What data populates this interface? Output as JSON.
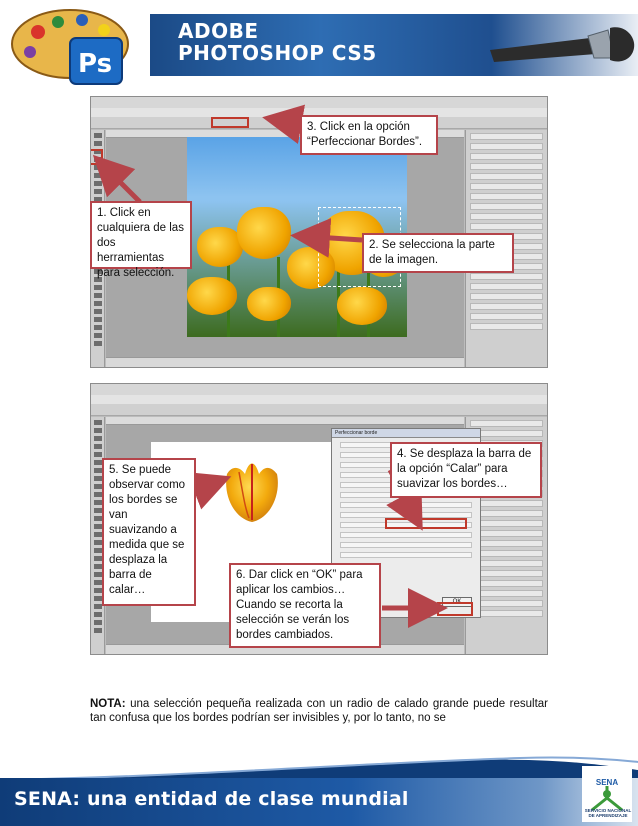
{
  "header": {
    "title_line1": "ADOBE",
    "title_line2": "PHOTOSHOP CS5",
    "logo_icon": "photoshop-ps-icon",
    "palette_icon": "paint-palette-icon",
    "brush_icon": "paintbrush-icon"
  },
  "screenshot1": {
    "highlighted_button": "Perfeccionar bordes"
  },
  "screenshot2": {
    "dialog_title": "Perfeccionar borde",
    "ok_label": "OK"
  },
  "callouts": {
    "c1": "1. Click en\ncualquiera de las\ndos herramientas\npara selección.",
    "c2": "2. Se selecciona la parte\nde la imagen.",
    "c3": "3. Click en la opción\n“Perfeccionar Bordes”.",
    "c4": "4. Se desplaza la barra de\nla opción “Calar” para\nsuavizar los bordes…",
    "c5": "5. Se puede\nobservar como\nlos bordes se\nvan\nsuavizando a\nmedida que se\ndesplaza la\nbarra de\ncalar…",
    "c6": "6. Dar click en “OK” para\naplicar los cambios…\nCuando se recorta la\nselección se verán los\nbordes cambiados."
  },
  "note": {
    "label": "NOTA:",
    "text": " una selección pequeña realizada con un radio de calado grande puede resultar tan confusa que los bordes podrían ser invisibles y, por lo tanto, no se"
  },
  "footer": {
    "slogan": "SENA: una entidad de clase mundial",
    "logo_word": "SENA",
    "logo_sub": "SERVICIO NACIONAL\nDE APRENDIZAJE"
  },
  "colors": {
    "callout_border": "#b5444a",
    "arrow": "#b5444a",
    "header_blue": "#1e5aa6",
    "footer_blue": "#0f3c78"
  }
}
